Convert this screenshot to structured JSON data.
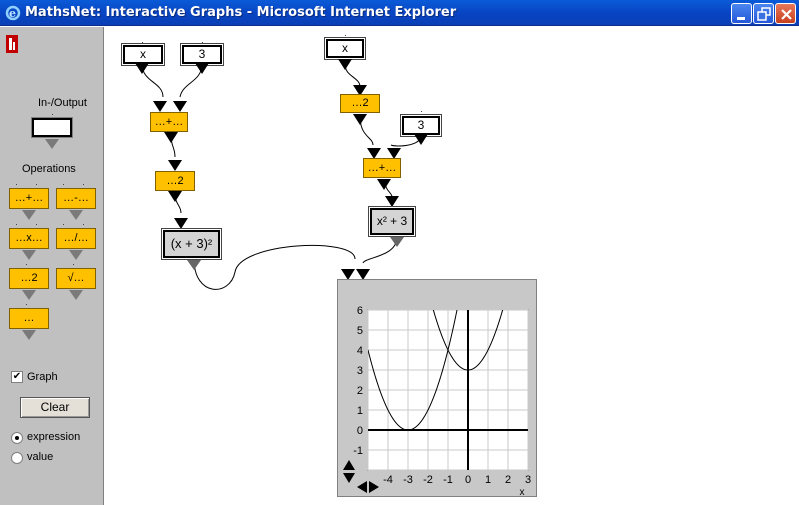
{
  "window": {
    "title": "MathsNet: Interactive Graphs - Microsoft Internet Explorer"
  },
  "sidebar": {
    "io_label": "In-/Output",
    "operations_label": "Operations",
    "ops": [
      {
        "label": "…+…"
      },
      {
        "label": "…-…"
      },
      {
        "label": "…x…"
      },
      {
        "label": "…/…"
      },
      {
        "label": "…2"
      },
      {
        "label": "√…"
      },
      {
        "label": "…"
      }
    ],
    "graph_checkbox_label": "Graph",
    "graph_checked": true,
    "clear_button": "Clear",
    "radio_expression": "expression",
    "radio_value": "value",
    "selected_mode": "expression"
  },
  "canvas": {
    "left_chain": {
      "input_x": "x",
      "input_3": "3",
      "add_op": "…+…",
      "square_op": "…2",
      "result": "(x + 3)²"
    },
    "right_chain": {
      "input_x": "x",
      "square_op": "…2",
      "input_3": "3",
      "add_op": "…+…",
      "result": "x² + 3"
    }
  },
  "chart_data": {
    "type": "line",
    "series": [
      {
        "expr": "(x + 3)^2"
      },
      {
        "expr": "x^2 + 3"
      }
    ],
    "xlim": [
      -5,
      3
    ],
    "ylim": [
      -2,
      6
    ],
    "x_ticks": [
      "-4",
      "-3",
      "-2",
      "-1",
      "0",
      "1",
      "2",
      "3"
    ],
    "y_ticks": [
      "6",
      "5",
      "4",
      "3",
      "2",
      "1",
      "0",
      "-1"
    ],
    "xlabel": "x",
    "grid": true
  }
}
